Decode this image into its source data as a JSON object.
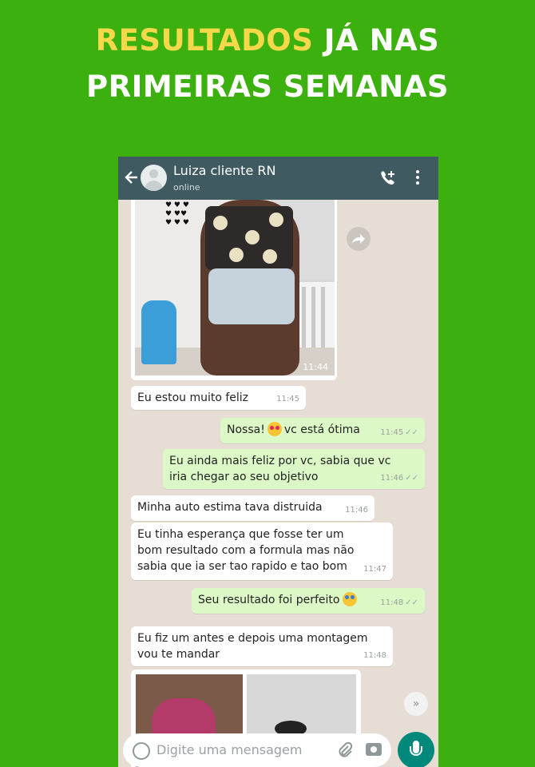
{
  "headline": {
    "highlight": "RESULTADOS",
    "line1_rest": "JÁ NAS",
    "line2": "PRIMEIRAS SEMANAS"
  },
  "chat_header": {
    "contact_name": "Luiza cliente RN",
    "status": "online"
  },
  "photo_message": {
    "time": "11:44"
  },
  "messages": [
    {
      "direction": "in",
      "text": "Eu estou muito feliz",
      "time": "11:45"
    },
    {
      "direction": "out",
      "text_before": "Nossa!",
      "emoji": "heart-eyes-emoji",
      "text_after": "vc está ótima",
      "time": "11:45"
    },
    {
      "direction": "out",
      "text": "Eu ainda mais feliz por vc, sabia que vc iria chegar ao seu objetivo",
      "time": "11:46"
    },
    {
      "direction": "in",
      "text": "Minha auto estima tava distruida",
      "time": "11:46"
    },
    {
      "direction": "in",
      "text": "Eu tinha esperança que fosse ter um bom resultado com a formula mas não sabia que ia ser tao rapido e tao bom",
      "time": "11:47"
    },
    {
      "direction": "out",
      "text": "Seu resultado foi perfeito",
      "emoji": "star-struck-emoji",
      "time": "11:48"
    },
    {
      "direction": "in",
      "text": "Eu fiz um antes e depois uma montagem vou te mandar",
      "time": "11:48"
    }
  ],
  "input_bar": {
    "placeholder": "Digite uma mensagem"
  },
  "colors": {
    "background": "#3cb00f",
    "headline_highlight": "#f6d84a",
    "header": "#3f5a60",
    "outgoing_bubble": "#dcf8c6",
    "mic_button": "#00897b"
  },
  "icons": [
    "back-arrow-icon",
    "call-add-icon",
    "more-vert-icon",
    "share-icon",
    "scroll-down-icon",
    "emoji-icon",
    "attach-clip-icon",
    "camera-icon",
    "mic-icon"
  ]
}
